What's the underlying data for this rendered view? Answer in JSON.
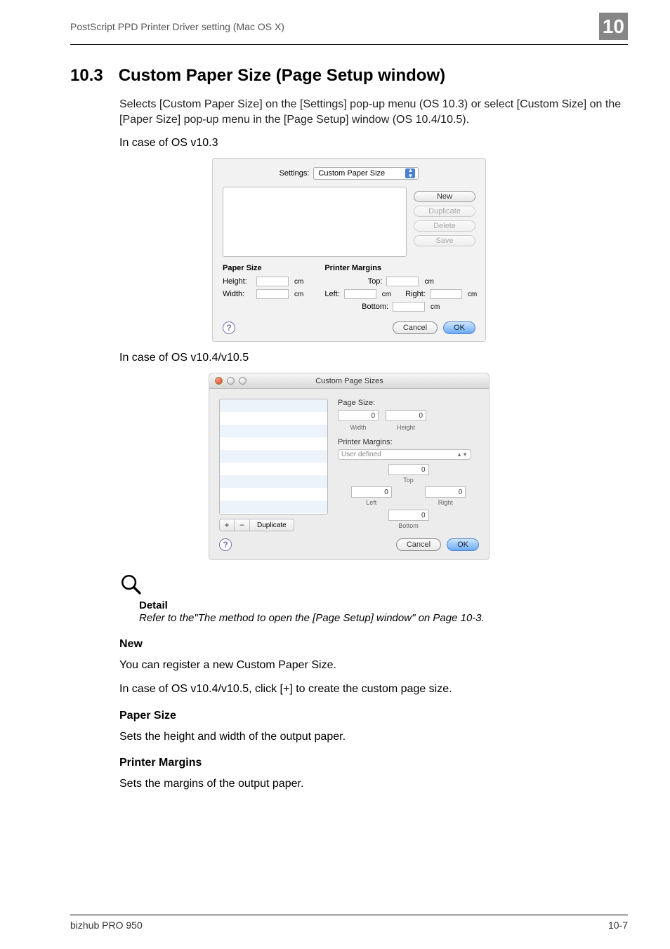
{
  "header": {
    "title": "PostScript PPD Printer Driver setting (Mac OS X)",
    "chapter": "10"
  },
  "h1": {
    "num": "10.3",
    "title": "Custom Paper Size (Page Setup window)"
  },
  "intro": "Selects [Custom Paper Size] on the [Settings] pop-up menu (OS 10.3) or select [Custom Size] on the [Paper Size] pop-up menu in the [Page Setup] window (OS 10.4/10.5).",
  "case103": "In case of OS v10.3",
  "case104": "In case of OS v10.4/v10.5",
  "dlg1": {
    "settings_label": "Settings:",
    "settings_value": "Custom Paper Size",
    "btn_new": "New",
    "btn_dup": "Duplicate",
    "btn_del": "Delete",
    "btn_save": "Save",
    "paper_size": "Paper Size",
    "printer_margins": "Printer Margins",
    "height": "Height:",
    "width": "Width:",
    "top": "Top:",
    "left": "Left:",
    "right": "Right:",
    "bottom": "Bottom:",
    "unit": "cm",
    "cancel": "Cancel",
    "ok": "OK"
  },
  "dlg2": {
    "title": "Custom Page Sizes",
    "page_size": "Page Size:",
    "width": "Width",
    "height": "Height",
    "printer_margins": "Printer Margins:",
    "user_defined": "User defined",
    "top": "Top",
    "left": "Left",
    "right": "Right",
    "bottom": "Bottom",
    "zero": "0",
    "plus": "+",
    "minus": "−",
    "duplicate": "Duplicate",
    "cancel": "Cancel",
    "ok": "OK"
  },
  "detail": {
    "title": "Detail",
    "body": "Refer to the\"The method to open the [Page Setup] window\" on Page 10-3."
  },
  "sections": {
    "new_h": "New",
    "new_p1": "You can register a new Custom Paper Size.",
    "new_p2": "In case of OS v10.4/v10.5, click [+] to create the custom page size.",
    "ps_h": "Paper Size",
    "ps_p": "Sets the height and width of the output paper.",
    "pm_h": "Printer Margins",
    "pm_p": "Sets the margins of the output paper."
  },
  "footer": {
    "left": "bizhub PRO 950",
    "right": "10-7"
  }
}
